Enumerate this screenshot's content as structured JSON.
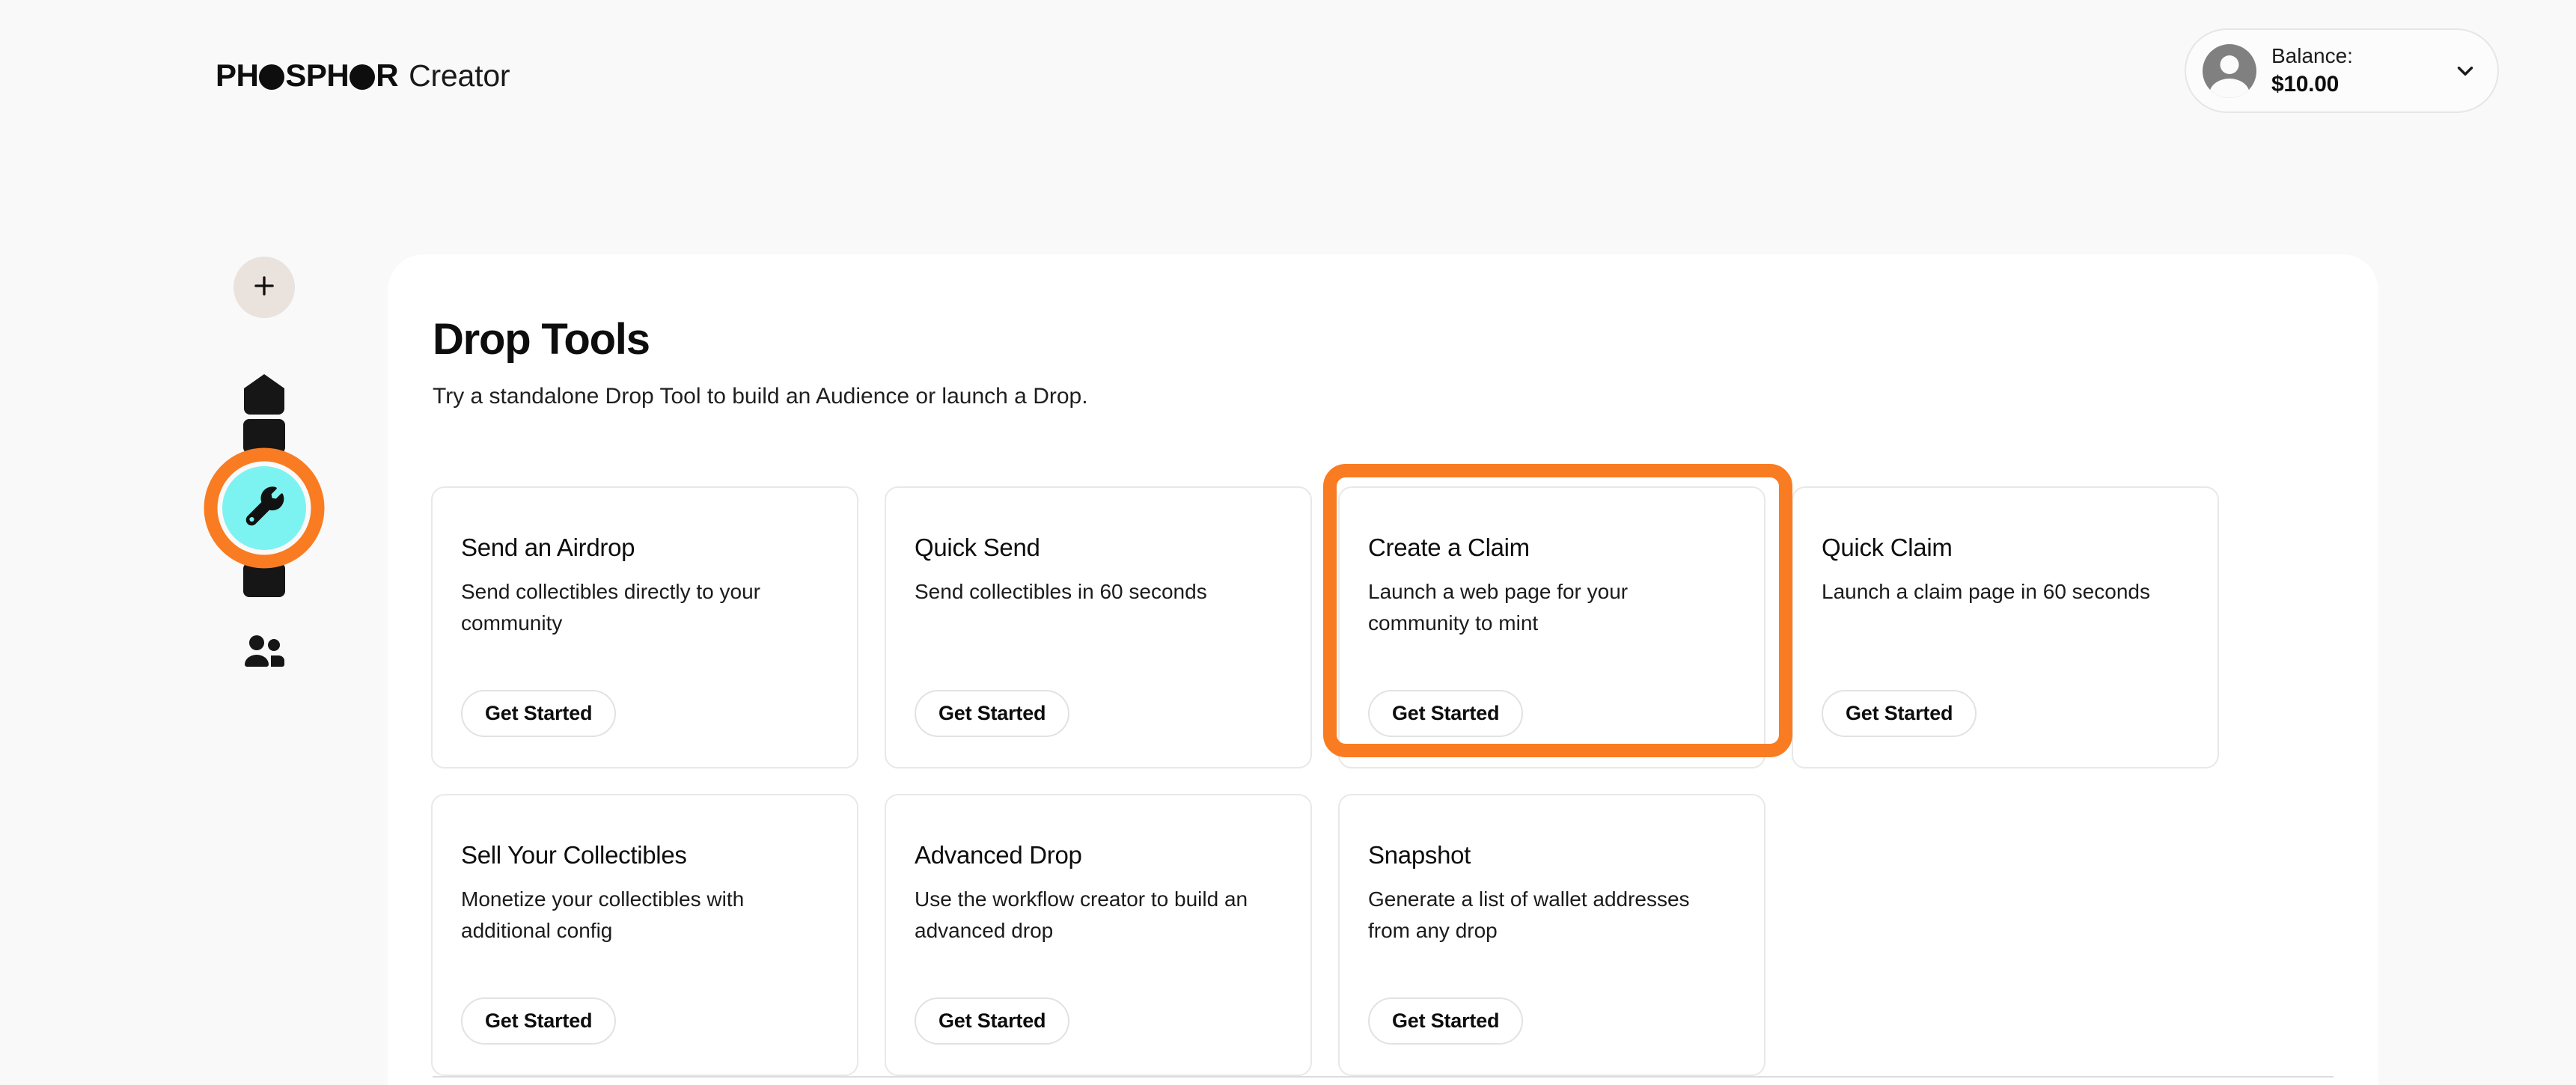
{
  "header": {
    "logo": {
      "brand_bold": "PHOSPHOR",
      "brand_part_1": "PH",
      "brand_part_2": "SPH",
      "brand_part_3": "R",
      "product": "Creator"
    },
    "account": {
      "balance_label": "Balance:",
      "balance_value": "$10.00",
      "avatar_icon": "user-avatar-icon",
      "chevron_icon": "chevron-down-icon"
    }
  },
  "sidebar": {
    "items": [
      {
        "name": "add",
        "icon": "plus-icon",
        "label": "Add"
      },
      {
        "name": "home",
        "icon": "home-pentagon-icon",
        "label": "Home"
      },
      {
        "name": "tools",
        "icon": "wrench-icon",
        "label": "Drop Tools",
        "active": true
      },
      {
        "name": "audience",
        "icon": "users-icon",
        "label": "Audience"
      }
    ]
  },
  "main": {
    "title": "Drop Tools",
    "subtitle": "Try a standalone Drop Tool to build an Audience or launch a Drop.",
    "cards": [
      {
        "title": "Send an Airdrop",
        "description": "Send collectibles directly to your community",
        "button_label": "Get Started",
        "highlighted": false
      },
      {
        "title": "Quick Send",
        "description": "Send collectibles in 60 seconds",
        "button_label": "Get Started",
        "highlighted": false
      },
      {
        "title": "Create a Claim",
        "description": "Launch a web page for your community to mint",
        "button_label": "Get Started",
        "highlighted": true
      },
      {
        "title": "Quick Claim",
        "description": "Launch a claim page in 60 seconds",
        "button_label": "Get Started",
        "highlighted": false
      },
      {
        "title": "Sell Your Collectibles",
        "description": "Monetize your collectibles with additional config",
        "button_label": "Get Started",
        "highlighted": false
      },
      {
        "title": "Advanced Drop",
        "description": "Use the workflow creator to build an advanced drop",
        "button_label": "Get Started",
        "highlighted": false
      },
      {
        "title": "Snapshot",
        "description": "Generate a list of wallet addresses from any drop",
        "button_label": "Get Started",
        "highlighted": false
      }
    ]
  },
  "colors": {
    "page_background": "#f9f9f9",
    "panel_background": "#ffffff",
    "annotation_orange": "#f97c22",
    "active_tool_cyan": "#7cf3f0",
    "add_button_beige": "#e9e2dd",
    "text_primary": "#0d0d0d",
    "card_border": "#e8e8e8"
  }
}
